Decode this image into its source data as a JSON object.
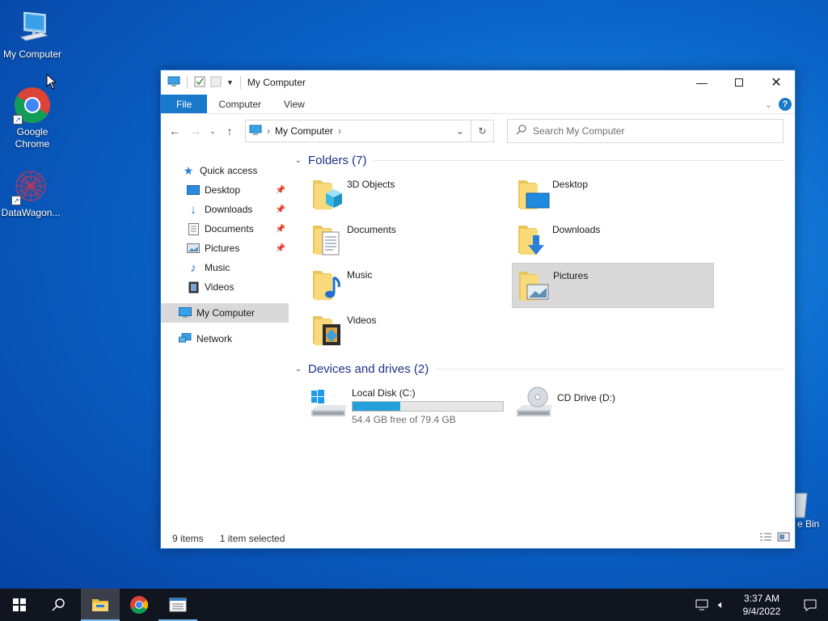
{
  "desktop": {
    "icons": [
      {
        "label": "My Computer"
      },
      {
        "label": "Google Chrome"
      },
      {
        "label": "DataWagon..."
      }
    ],
    "recycle_bin_partial": "e Bin"
  },
  "window": {
    "title": "My Computer",
    "ribbon_tabs": [
      "File",
      "Computer",
      "View"
    ],
    "address": {
      "crumb": "My Computer"
    },
    "search": {
      "placeholder": "Search My Computer"
    },
    "nav_pane": {
      "quick_access": "Quick access",
      "items": [
        {
          "label": "Desktop",
          "pinned": true
        },
        {
          "label": "Downloads",
          "pinned": true
        },
        {
          "label": "Documents",
          "pinned": true
        },
        {
          "label": "Pictures",
          "pinned": true
        },
        {
          "label": "Music",
          "pinned": false
        },
        {
          "label": "Videos",
          "pinned": false
        }
      ],
      "this_pc": "My Computer",
      "network": "Network"
    },
    "folders_header": "Folders (7)",
    "folders": [
      {
        "label": "3D Objects"
      },
      {
        "label": "Desktop"
      },
      {
        "label": "Documents"
      },
      {
        "label": "Downloads"
      },
      {
        "label": "Music"
      },
      {
        "label": "Pictures",
        "selected": true
      },
      {
        "label": "Videos"
      }
    ],
    "drives_header": "Devices and drives (2)",
    "drives": [
      {
        "label": "Local Disk (C:)",
        "free_text": "54.4 GB free of 79.4 GB",
        "used_fraction": 0.315
      },
      {
        "label": "CD Drive (D:)"
      }
    ],
    "status": {
      "items": "9 items",
      "selected": "1 item selected"
    }
  },
  "taskbar": {
    "time": "3:37 AM",
    "date": "9/4/2022"
  },
  "colors": {
    "accent": "#1979ca",
    "selection": "#d9d9d9",
    "taskbar": "#101520",
    "drive_bar": "#26a0da"
  }
}
